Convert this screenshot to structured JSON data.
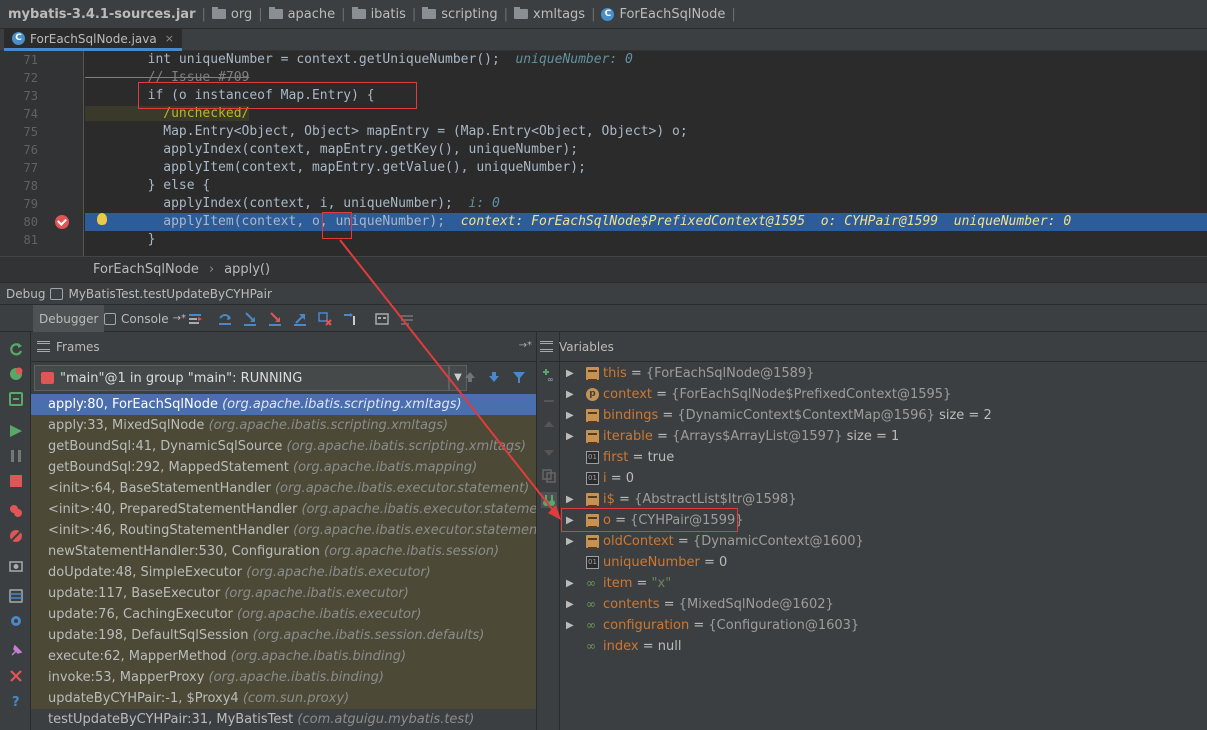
{
  "breadcrumb": {
    "items": [
      {
        "label": "mybatis-3.4.1-sources.jar",
        "icon": "none"
      },
      {
        "label": "org",
        "icon": "folder-icon"
      },
      {
        "label": "apache",
        "icon": "folder-icon"
      },
      {
        "label": "ibatis",
        "icon": "folder-icon"
      },
      {
        "label": "scripting",
        "icon": "folder-icon"
      },
      {
        "label": "xmltags",
        "icon": "folder-icon"
      },
      {
        "label": "ForEachSqlNode",
        "icon": "class-icon"
      }
    ]
  },
  "tabs": {
    "file": {
      "label": "ForEachSqlNode.java",
      "icon": "class-icon",
      "close": "×"
    }
  },
  "editor": {
    "lines": [
      {
        "num": "71",
        "code": "        int uniqueNumber = context.getUniqueNumber();",
        "debug": "uniqueNumber: 0"
      },
      {
        "num": "72",
        "code": "        // Issue #709"
      },
      {
        "num": "73",
        "code": "        if (o instanceof Map.Entry) {"
      },
      {
        "num": "74",
        "code": "          /unchecked/"
      },
      {
        "num": "75",
        "code": "          Map.Entry<Object, Object> mapEntry = (Map.Entry<Object, Object>) o;"
      },
      {
        "num": "76",
        "code": "          applyIndex(context, mapEntry.getKey(), uniqueNumber);"
      },
      {
        "num": "77",
        "code": "          applyItem(context, mapEntry.getValue(), uniqueNumber);"
      },
      {
        "num": "78",
        "code": "        } else {"
      },
      {
        "num": "79",
        "code": "          applyIndex(context, i, uniqueNumber);",
        "debug": "i: 0"
      },
      {
        "num": "80",
        "code": "          applyItem(context, o, uniqueNumber);",
        "debug": "context: ForEachSqlNode$PrefixedContext@1595  o: CYHPair@1599  uniqueNumber: 0"
      },
      {
        "num": "81",
        "code": "        }"
      }
    ]
  },
  "method_breadcrumb": {
    "class": "ForEachSqlNode",
    "sep": "›",
    "method": "apply()"
  },
  "debug_window": {
    "title": "Debug",
    "config": "MyBatisTest.testUpdateByCYHPair"
  },
  "debug_tabs": {
    "debugger": "Debugger",
    "console": "Console",
    "console_suffix": "→*"
  },
  "frames": {
    "title": "Frames",
    "thread": "\"main\"@1 in group \"main\": RUNNING",
    "items": [
      {
        "method": "apply:80, ForEachSqlNode",
        "pkg": "(org.apache.ibatis.scripting.xmltags)"
      },
      {
        "method": "apply:33, MixedSqlNode",
        "pkg": "(org.apache.ibatis.scripting.xmltags)"
      },
      {
        "method": "getBoundSql:41, DynamicSqlSource",
        "pkg": "(org.apache.ibatis.scripting.xmltags)"
      },
      {
        "method": "getBoundSql:292, MappedStatement",
        "pkg": "(org.apache.ibatis.mapping)"
      },
      {
        "method": "<init>:64, BaseStatementHandler",
        "pkg": "(org.apache.ibatis.executor.statement)"
      },
      {
        "method": "<init>:40, PreparedStatementHandler",
        "pkg": "(org.apache.ibatis.executor.statement)"
      },
      {
        "method": "<init>:46, RoutingStatementHandler",
        "pkg": "(org.apache.ibatis.executor.statement)"
      },
      {
        "method": "newStatementHandler:530, Configuration",
        "pkg": "(org.apache.ibatis.session)"
      },
      {
        "method": "doUpdate:48, SimpleExecutor",
        "pkg": "(org.apache.ibatis.executor)"
      },
      {
        "method": "update:117, BaseExecutor",
        "pkg": "(org.apache.ibatis.executor)"
      },
      {
        "method": "update:76, CachingExecutor",
        "pkg": "(org.apache.ibatis.executor)"
      },
      {
        "method": "update:198, DefaultSqlSession",
        "pkg": "(org.apache.ibatis.session.defaults)"
      },
      {
        "method": "execute:62, MapperMethod",
        "pkg": "(org.apache.ibatis.binding)"
      },
      {
        "method": "invoke:53, MapperProxy",
        "pkg": "(org.apache.ibatis.binding)"
      },
      {
        "method": "updateByCYHPair:-1, $Proxy4",
        "pkg": "(com.sun.proxy)"
      },
      {
        "method": "testUpdateByCYHPair:31, MyBatisTest",
        "pkg": "(com.atguigu.mybatis.test)"
      }
    ]
  },
  "variables": {
    "title": "Variables",
    "items": [
      {
        "name": "this",
        "value": "{ForEachSqlNode@1589}",
        "extra": "",
        "kind": "field",
        "expandable": true
      },
      {
        "name": "context",
        "value": "{ForEachSqlNode$PrefixedContext@1595}",
        "extra": "",
        "kind": "param",
        "expandable": true
      },
      {
        "name": "bindings",
        "value": "{DynamicContext$ContextMap@1596}",
        "extra": "size = 2",
        "kind": "field",
        "expandable": true
      },
      {
        "name": "iterable",
        "value": "{Arrays$ArrayList@1597}",
        "extra": "size = 1",
        "kind": "field",
        "expandable": true
      },
      {
        "name": "first",
        "value": "true",
        "extra": "",
        "kind": "prim",
        "expandable": false
      },
      {
        "name": "i",
        "value": "0",
        "extra": "",
        "kind": "prim",
        "expandable": false
      },
      {
        "name": "i$",
        "value": "{AbstractList$Itr@1598}",
        "extra": "",
        "kind": "field",
        "expandable": true
      },
      {
        "name": "o",
        "value": "{CYHPair@1599}",
        "extra": "",
        "kind": "field",
        "expandable": true
      },
      {
        "name": "oldContext",
        "value": "{DynamicContext@1600}",
        "extra": "",
        "kind": "field",
        "expandable": true
      },
      {
        "name": "uniqueNumber",
        "value": "0",
        "extra": "",
        "kind": "prim",
        "expandable": false
      },
      {
        "name": "item",
        "value": "\"x\"",
        "extra": "",
        "kind": "watch",
        "expandable": true
      },
      {
        "name": "contents",
        "value": "{MixedSqlNode@1602}",
        "extra": "",
        "kind": "watch",
        "expandable": true
      },
      {
        "name": "configuration",
        "value": "{Configuration@1603}",
        "extra": "",
        "kind": "watch",
        "expandable": true
      },
      {
        "name": "index",
        "value": "null",
        "extra": "",
        "kind": "watch",
        "expandable": false
      }
    ]
  },
  "colors": {
    "accent": "#4b6eaf",
    "annotation": "#e03c3c",
    "exec_line": "#2d5c9a"
  }
}
